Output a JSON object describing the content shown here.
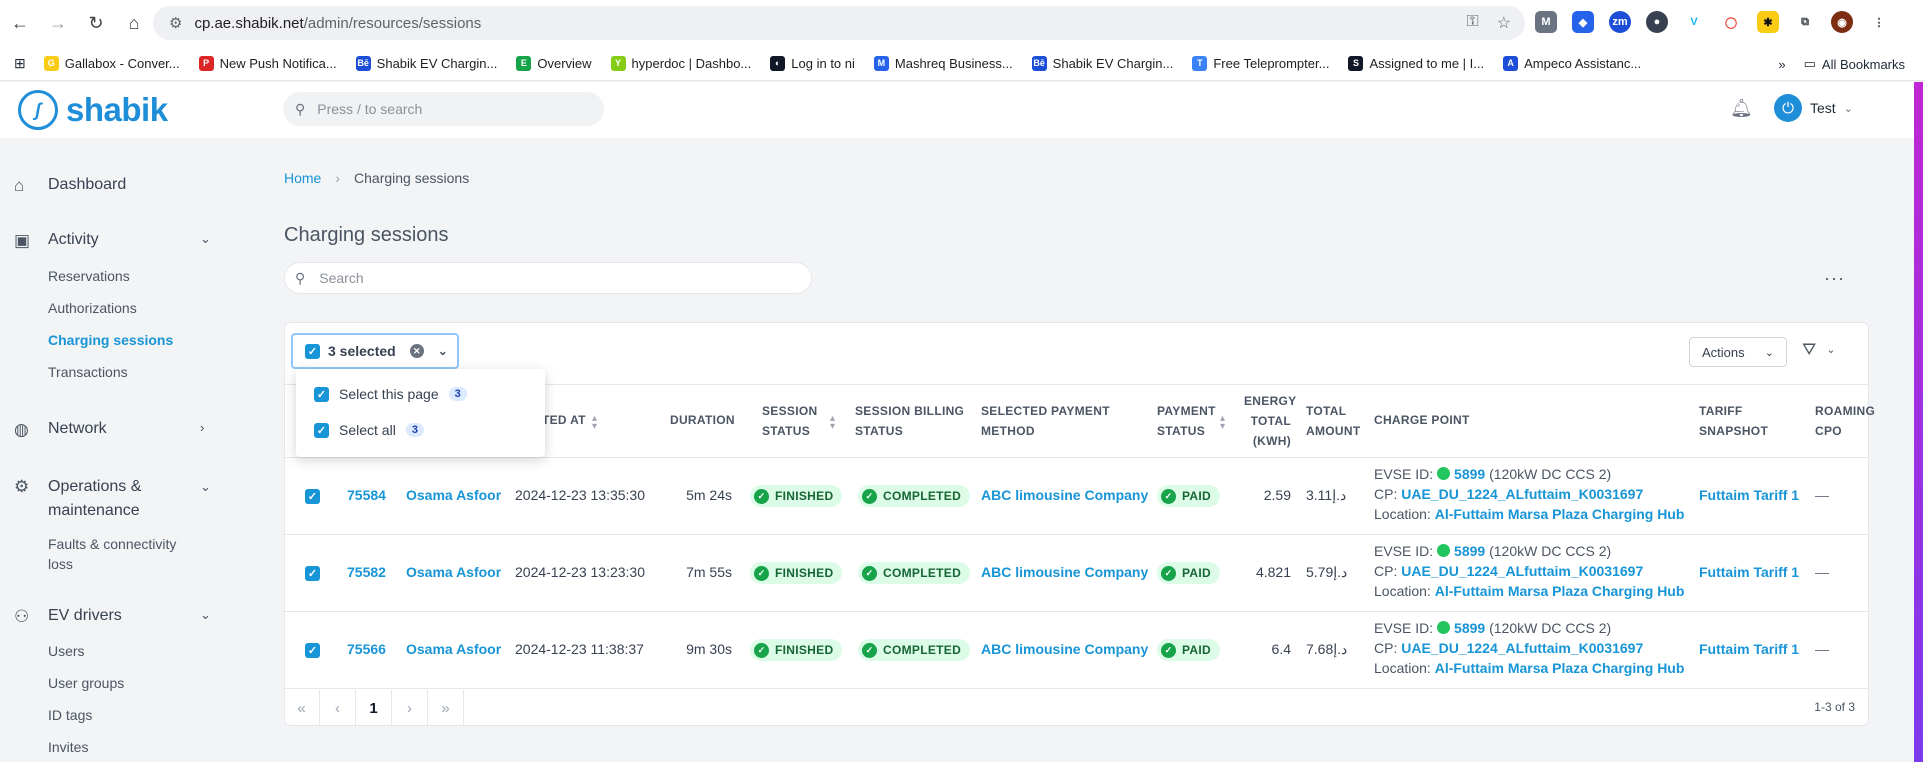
{
  "browser": {
    "url_host": "cp.ae.shabik.net",
    "url_path": "/admin/resources/sessions",
    "bookmarks": [
      {
        "label": "Gallabox - Conver...",
        "color": "#facc15",
        "glyph": "G"
      },
      {
        "label": "New Push Notifica...",
        "color": "#dc2626",
        "glyph": "P"
      },
      {
        "label": "Shabik EV Chargin...",
        "color": "#1d4ed8",
        "glyph": "Bē"
      },
      {
        "label": "Overview",
        "color": "#16a34a",
        "glyph": "E"
      },
      {
        "label": "hyperdoc | Dashbo...",
        "color": "#84cc16",
        "glyph": "Y"
      },
      {
        "label": "Log in to ni",
        "color": "#111827",
        "glyph": "◐"
      },
      {
        "label": "Mashreq Business...",
        "color": "#2563eb",
        "glyph": "M"
      },
      {
        "label": "Shabik EV Chargin...",
        "color": "#1d4ed8",
        "glyph": "Bē"
      },
      {
        "label": "Free Teleprompter...",
        "color": "#3b82f6",
        "glyph": "T"
      },
      {
        "label": "Assigned to me | I...",
        "color": "#111827",
        "glyph": "S"
      },
      {
        "label": "Ampeco Assistanc...",
        "color": "#1d4ed8",
        "glyph": "A"
      }
    ],
    "all_bookmarks_label": "All Bookmarks",
    "overflow_label": "»"
  },
  "app": {
    "logo_text": "shabik",
    "search_placeholder": "Press / to search",
    "user_name": "Test"
  },
  "sidebar": {
    "dashboard": "Dashboard",
    "activity": "Activity",
    "activity_items": [
      "Reservations",
      "Authorizations",
      "Charging sessions",
      "Transactions"
    ],
    "network": "Network",
    "operations_line1": "Operations &",
    "operations_line2": "maintenance",
    "operations_items_line1": "Faults & connectivity",
    "operations_items_line2": "loss",
    "ev_drivers": "EV drivers",
    "ev_items": [
      "Users",
      "User groups",
      "ID tags",
      "Invites"
    ]
  },
  "main": {
    "breadcrumb_home": "Home",
    "breadcrumb_current": "Charging sessions",
    "title": "Charging sessions",
    "search_placeholder": "Search",
    "selected_label": "3 selected",
    "actions_label": "Actions",
    "dropdown": {
      "select_page": "Select this page",
      "select_page_count": "3",
      "select_all": "Select all",
      "select_all_count": "3"
    }
  },
  "table": {
    "headers": {
      "started_at": "TED AT",
      "duration": "DURATION",
      "session_status_1": "SESSION",
      "session_status_2": "STATUS",
      "billing_1": "SESSION BILLING",
      "billing_2": "STATUS",
      "payment_method_1": "SELECTED PAYMENT",
      "payment_method_2": "METHOD",
      "payment_status_1": "PAYMENT",
      "payment_status_2": "STATUS",
      "energy_1": "ENERGY",
      "energy_2": "TOTAL",
      "energy_3": "(KWH)",
      "amount_1": "TOTAL",
      "amount_2": "AMOUNT",
      "charge_point": "CHARGE POINT",
      "tariff_1": "TARIFF",
      "tariff_2": "SNAPSHOT",
      "roaming_1": "ROAMING",
      "roaming_2": "CPO"
    },
    "rows": [
      {
        "id": "75584",
        "user": "Osama Asfoor",
        "started": "2024-12-23 13:35:30",
        "duration": "5m 24s",
        "status": "FINISHED",
        "billing": "COMPLETED",
        "payment_method": "ABC limousine Company",
        "payment_status": "PAID",
        "energy": "2.59",
        "amount": "3.11د.إ",
        "evse_prefix": "EVSE ID:",
        "evse_id": "5899",
        "evse_desc": "(120kW DC CCS 2)",
        "cp_prefix": "CP:",
        "cp": "UAE_DU_1224_ALfuttaim_K0031697",
        "loc_prefix": "Location:",
        "location": "Al-Futtaim Marsa Plaza Charging Hub",
        "tariff": "Futtaim Tariff 1",
        "roaming": "—"
      },
      {
        "id": "75582",
        "user": "Osama Asfoor",
        "started": "2024-12-23 13:23:30",
        "duration": "7m 55s",
        "status": "FINISHED",
        "billing": "COMPLETED",
        "payment_method": "ABC limousine Company",
        "payment_status": "PAID",
        "energy": "4.821",
        "amount": "5.79د.إ",
        "evse_prefix": "EVSE ID:",
        "evse_id": "5899",
        "evse_desc": "(120kW DC CCS 2)",
        "cp_prefix": "CP:",
        "cp": "UAE_DU_1224_ALfuttaim_K0031697",
        "loc_prefix": "Location:",
        "location": "Al-Futtaim Marsa Plaza Charging Hub",
        "tariff": "Futtaim Tariff 1",
        "roaming": "—"
      },
      {
        "id": "75566",
        "user": "Osama Asfoor",
        "started": "2024-12-23 11:38:37",
        "duration": "9m 30s",
        "status": "FINISHED",
        "billing": "COMPLETED",
        "payment_method": "ABC limousine Company",
        "payment_status": "PAID",
        "energy": "6.4",
        "amount": "7.68د.إ",
        "evse_prefix": "EVSE ID:",
        "evse_id": "5899",
        "evse_desc": "(120kW DC CCS 2)",
        "cp_prefix": "CP:",
        "cp": "UAE_DU_1224_ALfuttaim_K0031697",
        "loc_prefix": "Location:",
        "location": "Al-Futtaim Marsa Plaza Charging Hub",
        "tariff": "Futtaim Tariff 1",
        "roaming": "—"
      }
    ]
  },
  "pagination": {
    "first": "«",
    "prev": "‹",
    "page": "1",
    "next": "›",
    "last": "»",
    "count": "1-3 of 3"
  },
  "colors": {
    "accent": "#1795d6",
    "success_bg": "#dcfce7",
    "success": "#16a34a"
  }
}
